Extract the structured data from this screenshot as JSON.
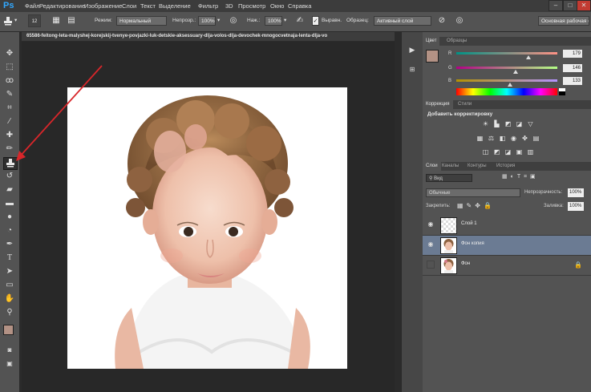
{
  "app": {
    "logo": "Ps"
  },
  "menu": [
    "Файл",
    "Редактирование",
    "Изображение",
    "Слои",
    "Текст",
    "Выделение",
    "Фильтр",
    "3D",
    "Просмотр",
    "Окно",
    "Справка"
  ],
  "window_buttons": [
    "–",
    "□",
    "✕"
  ],
  "options": {
    "brush_size": "12",
    "mode_label": "Режим:",
    "mode_value": "Нормальный",
    "opacity_label": "Непрозр.:",
    "opacity_value": "100%",
    "flow_label": "Наж.:",
    "flow_value": "100%",
    "aligned_label": "Выравн.",
    "sample_label": "Образец:",
    "sample_value": "Активный слой",
    "workspace": "Основная рабочая ср"
  },
  "document": {
    "tab_title": "65586-feitong-leta-malyshej-korejskij-tvenye-povjazki-luk-detskie-aksessuary-dlja-volos-dlja-devochek-mnogocvetnaja-lenta-dlja-vo"
  },
  "tools": [
    "move-icon",
    "marquee-icon",
    "lasso-icon",
    "quick-select-icon",
    "crop-icon",
    "eyedropper-icon",
    "healing-icon",
    "brush-icon",
    "clone-stamp-icon",
    "history-brush-icon",
    "eraser-icon",
    "gradient-icon",
    "blur-icon",
    "dodge-icon",
    "pen-icon",
    "type-icon",
    "path-select-icon",
    "shape-icon",
    "hand-icon",
    "zoom-icon"
  ],
  "color_panel": {
    "tabs": [
      "Цвет",
      "Образцы"
    ],
    "channels": [
      {
        "label": "R",
        "value": "179"
      },
      {
        "label": "G",
        "value": "146"
      },
      {
        "label": "B",
        "value": "133"
      }
    ],
    "foreground": "#b39285",
    "background": "#ffffff"
  },
  "adjust_panel": {
    "tabs": [
      "Коррекция",
      "Стили"
    ],
    "heading": "Добавить корректировку"
  },
  "layers_panel": {
    "tabs": [
      "Слои",
      "Каналы",
      "Контуры",
      "История"
    ],
    "filter_label": "Вид",
    "blend_mode": "Обычные",
    "opacity_label": "Непрозрачность:",
    "opacity_value": "100%",
    "lock_label": "Закрепить:",
    "fill_label": "Заливка:",
    "fill_value": "100%",
    "layers": [
      {
        "name": "Слой 1",
        "visible": true,
        "selected": false
      },
      {
        "name": "Фон копия",
        "visible": true,
        "selected": true
      },
      {
        "name": "Фон",
        "visible": false,
        "selected": false,
        "locked": true
      }
    ]
  },
  "colors": {
    "accent": "#31a8ff",
    "selection": "#6b7b93",
    "annotation_arrow": "#d8262a"
  }
}
